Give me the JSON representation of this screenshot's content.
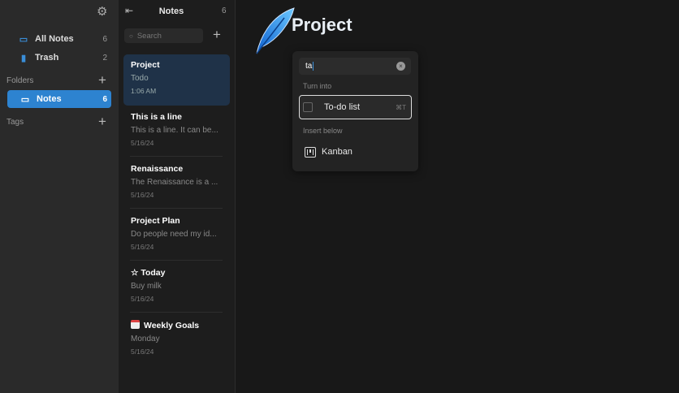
{
  "sidebar": {
    "items": [
      {
        "label": "All Notes",
        "count": "6",
        "icon": "folder-icon"
      },
      {
        "label": "Trash",
        "count": "2",
        "icon": "trash-icon"
      }
    ],
    "folders_label": "Folders",
    "folders": [
      {
        "label": "Notes",
        "count": "6"
      }
    ],
    "tags_label": "Tags"
  },
  "list": {
    "title": "Notes",
    "count": "6",
    "search_placeholder": "Search",
    "notes": [
      {
        "title": "Project",
        "snippet": "Todo",
        "date": "1:06 AM"
      },
      {
        "title": "This is a line",
        "snippet": "This is a line. It can be...",
        "date": "5/16/24"
      },
      {
        "title": "Renaissance",
        "snippet": "The Renaissance is a ...",
        "date": "5/16/24"
      },
      {
        "title": "Project Plan",
        "snippet": "Do people need my id...",
        "date": "5/16/24"
      },
      {
        "title": "☆ Today",
        "snippet": "Buy milk",
        "date": "5/16/24"
      },
      {
        "title": "Weekly Goals",
        "snippet": "Monday",
        "date": "5/16/24"
      }
    ]
  },
  "editor": {
    "title": "Project"
  },
  "popup": {
    "query": "ta",
    "turn_into_label": "Turn into",
    "todo_label": "To-do list",
    "todo_shortcut": "⌘T",
    "insert_below_label": "Insert below",
    "kanban_label": "Kanban"
  },
  "colors": {
    "accent": "#2d83d0",
    "selected_note": "#1f3248"
  }
}
